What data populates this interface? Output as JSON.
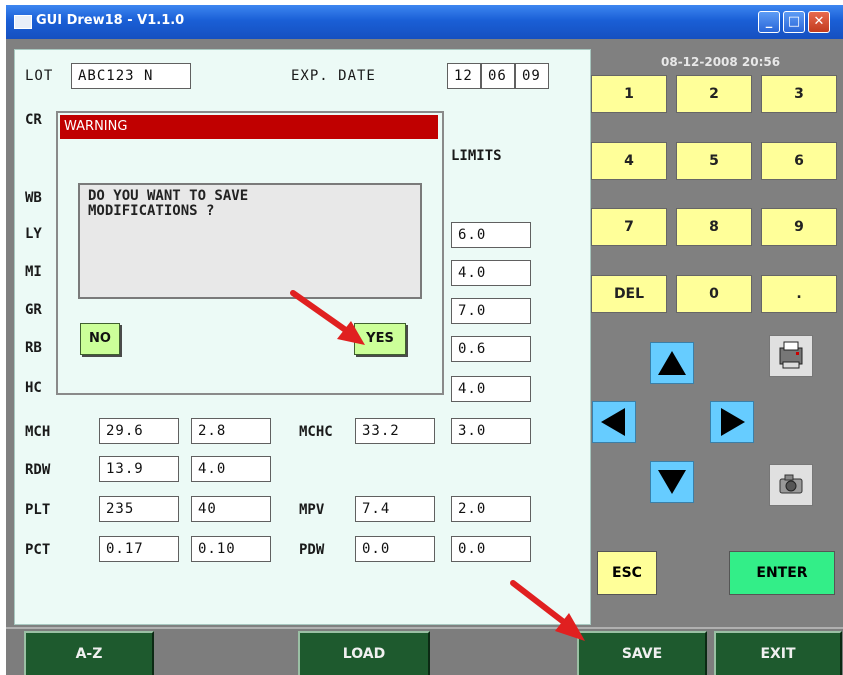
{
  "window": {
    "title": "GUI Drew18 - V1.1.0"
  },
  "form": {
    "lot_label": "LOT",
    "lot_value": "ABC123 N",
    "exp_label": "EXP. DATE",
    "exp_day": "12",
    "exp_month": "06",
    "exp_year": "09",
    "cr_label": "CR",
    "limits_label": "LIMITS",
    "rows": {
      "wb": "WB",
      "ly": "LY",
      "mi": "MI",
      "gr": "GR",
      "rb": "RB",
      "hc": "HC",
      "mch": "MCH",
      "rdw": "RDW",
      "plt": "PLT",
      "pct": "PCT",
      "mchc": "MCHC",
      "mpv": "MPV",
      "pdw": "PDW"
    },
    "values": {
      "ly_lim": "6.0",
      "mi_lim": "4.0",
      "gr_lim": "7.0",
      "rb_lim": "0.6",
      "hc_lim": "4.0",
      "mch_v": "29.6",
      "mch_l": "2.8",
      "mchc_v": "33.2",
      "mchc_l": "3.0",
      "rdw_v": "13.9",
      "rdw_l": "4.0",
      "plt_v": "235",
      "plt_l": "40",
      "mpv_v": "7.4",
      "mpv_l": "2.0",
      "pct_v": "0.17",
      "pct_l": "0.10",
      "pdw_v": "0.0",
      "pdw_l": "0.0"
    }
  },
  "dialog": {
    "title": "WARNING",
    "message": "DO YOU WANT TO SAVE\nMODIFICATIONS ?",
    "no": "NO",
    "yes": "YES"
  },
  "keypad": {
    "datetime": "08-12-2008 20:56",
    "keys": [
      "1",
      "2",
      "3",
      "4",
      "5",
      "6",
      "7",
      "8",
      "9",
      "DEL",
      "0",
      "."
    ],
    "esc": "ESC",
    "enter": "ENTER"
  },
  "nav": {
    "az": "A-Z",
    "load": "LOAD",
    "save": "SAVE",
    "exit": "EXIT"
  },
  "colors": {
    "title_bar": "#1a5fd6",
    "warning": "#c00000",
    "keypad": "#ffff99",
    "nav": "#1e5a2e",
    "dialog_button": "#ccff99",
    "annotation_arrow": "#e02020"
  }
}
